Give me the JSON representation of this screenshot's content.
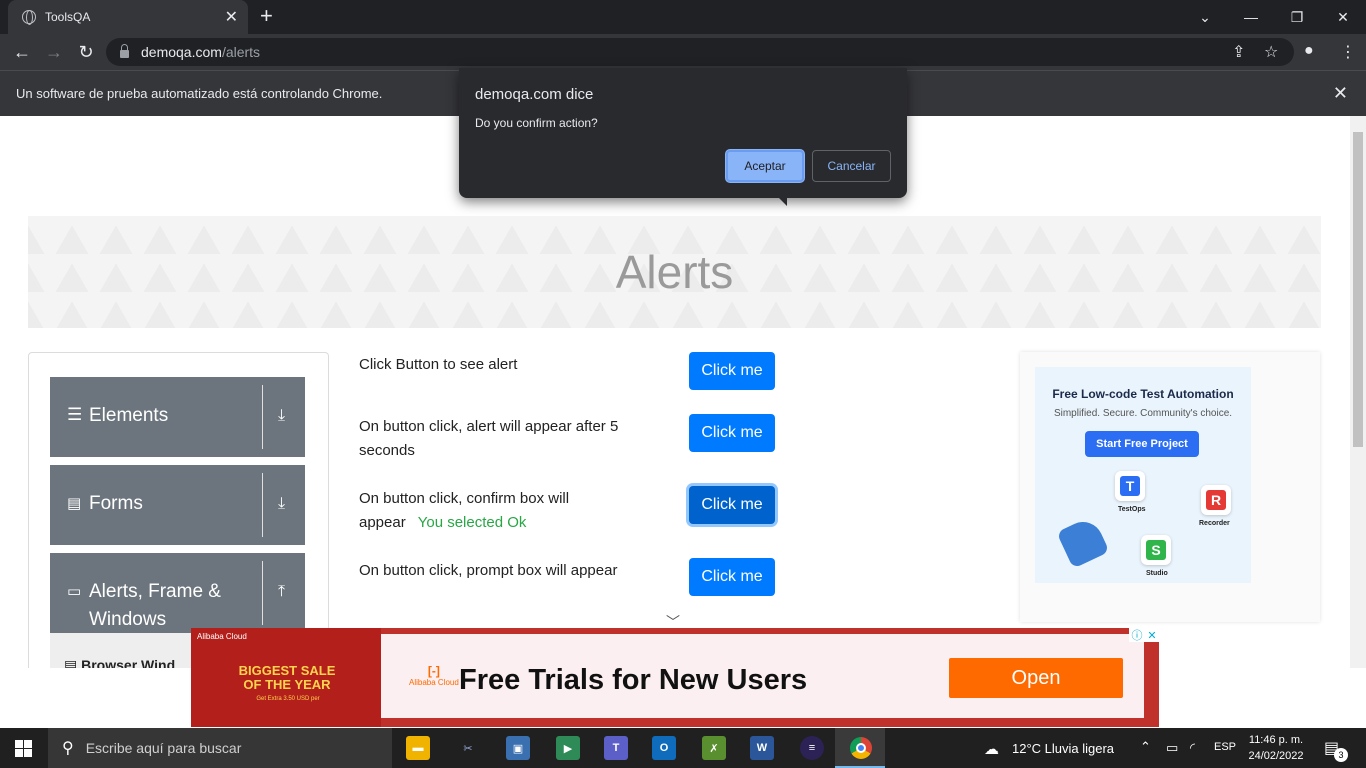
{
  "browser": {
    "tab_title": "ToolsQA",
    "url_host": "demoqa.com",
    "url_path": "/alerts",
    "infobar_text": "Un software de prueba automatizado está controlando Chrome."
  },
  "dialog": {
    "title": "demoqa.com dice",
    "message": "Do you confirm action?",
    "ok_label": "Aceptar",
    "cancel_label": "Cancelar"
  },
  "page": {
    "heading": "Alerts",
    "sidebar": {
      "groups": [
        {
          "label": "Elements",
          "icon": "hamburger-icon",
          "arrow": "download-arrow-icon"
        },
        {
          "label": "Forms",
          "icon": "document-icon",
          "arrow": "download-arrow-icon"
        },
        {
          "label": "Alerts, Frame & Windows",
          "icon": "window-icon",
          "arrow": "upload-arrow-icon"
        }
      ],
      "sub_item": "Browser Wind"
    },
    "rows": [
      {
        "text": "Click Button to see alert",
        "button": "Click me"
      },
      {
        "text": "On button click, alert will appear after 5 seconds",
        "button": "Click me"
      },
      {
        "text": "On button click, confirm box will appear",
        "result": "You selected Ok",
        "button": "Click me"
      },
      {
        "text": "On button click, prompt box will appear",
        "button": "Click me"
      }
    ]
  },
  "ad_right": {
    "title": "Free Low-code Test Automation",
    "subtitle": "Simplified. Secure. Community's choice.",
    "cta": "Start Free Project",
    "products": [
      "TestOps",
      "Recorder",
      "Studio"
    ]
  },
  "ad_bottom": {
    "brand_small": "Alibaba Cloud",
    "sale_line1": "BIGGEST SALE",
    "sale_line2": "OF THE YEAR",
    "sale_sub": "Get Extra 3.50 USD per",
    "brand": "Alibaba Cloud",
    "headline": "Free Trials for New Users",
    "cta": "Open"
  },
  "taskbar": {
    "search_placeholder": "Escribe aquí para buscar",
    "weather": "12°C  Lluvia ligera",
    "language": "ESP",
    "time": "11:46 p. m.",
    "date": "24/02/2022",
    "notification_count": "3"
  },
  "colors": {
    "accent": "#007bff",
    "success": "#28a745",
    "sidebar_group": "#6c757d"
  }
}
